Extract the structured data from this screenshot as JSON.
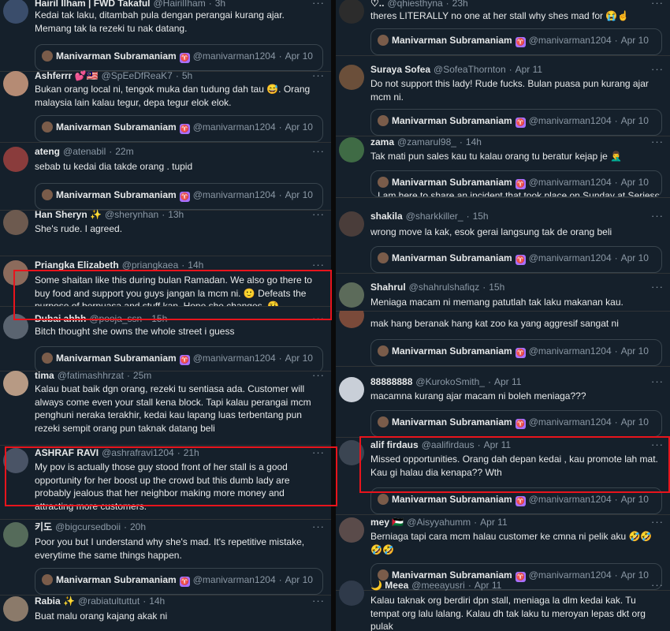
{
  "accent_color": "#e8141c",
  "badge_icon": "aries-sign-icon",
  "quote_author": {
    "name": "Manivarman Subramaniam",
    "handle": "@manivarman1204",
    "date": "Apr 10"
  },
  "left_column": [
    {
      "name": "Hairil Ilham | FWD Takaful",
      "handle": "@HairilIham",
      "time": "3h",
      "text": "Kedai tak laku, ditambah pula dengan perangai kurang ajar. Memang tak la rezeki tu nak datang."
    },
    {
      "name": "Ashferrr 💕🇲🇾",
      "handle": "@SpEeDfReaK7",
      "time": "5h",
      "text": "Bukan orang local ni, tengok muka dan tudung dah tau 😅. Orang malaysia lain kalau tegur, depa tegur elok elok."
    },
    {
      "name": "ateng",
      "handle": "@atenabil",
      "time": "22m",
      "text": "sebab tu kedai dia takde orang . tupid"
    },
    {
      "name": "Han Sheryn ✨",
      "handle": "@sherynhan",
      "time": "13h",
      "text": "She's rude. I agreed."
    },
    {
      "name": "Priangka Elizabeth",
      "handle": "@priangkaea",
      "time": "14h",
      "text": "Some shaitan like this during bulan Ramadan. We also go there to buy food and support you guys jangan la mcm ni. 🙂 Defeats the purpose of berpuasa and stuff kan. Hope she changes. 🤨"
    },
    {
      "name": "Dubai ahhh",
      "handle": "@pooja_ssn",
      "time": "15h",
      "text": "Bitch thought she owns the whole street i guess"
    },
    {
      "name": "tima",
      "handle": "@fatimashhrzat",
      "time": "25m",
      "text": "Kalau buat baik dgn orang, rezeki tu sentiasa ada. Customer will always come even your stall kena block. Tapi kalau perangai mcm penghuni neraka terakhir, kedai kau lapang luas terbentang pun rezeki sempit orang pun taknak datang beli"
    },
    {
      "name": "ASHRAF RAVI",
      "handle": "@ashrafravi1204",
      "time": "21h",
      "text": "My pov is actually those guy stood front of her stall is a good opportunity for her boost up the crowd but this dumb lady are probably jealous that her neighbor making more money and attracting more customers."
    },
    {
      "name": "키도",
      "handle": "@bigcursedboii",
      "time": "20h",
      "text": "Poor you but I understand why she's mad. It's repetitive mistake, everytime the same things happen."
    },
    {
      "name": "Rabia ✨",
      "handle": "@rabiatultuttut",
      "time": "14h",
      "text": "Buat malu orang kajang akak ni"
    }
  ],
  "right_column": [
    {
      "name": "♡..",
      "handle": "@qhiesthyna",
      "time": "23h",
      "text": "theres LITERALLY no one at her stall why shes mad for 😭☝️"
    },
    {
      "name": "Suraya Sofea",
      "handle": "@SofeaThornton",
      "time": "Apr 11",
      "text": "Do not support this lady! Rude fucks. Bulan puasa pun kurang ajar mcm ni."
    },
    {
      "name": "zama",
      "handle": "@zamarul98_",
      "time": "14h",
      "text": "Tak mati pun sales kau tu kalau orang tu beratur kejap je 🤦‍♂️",
      "quote_text": "I am here to share an incident that took place on Sunday at Seriese"
    },
    {
      "name": "shakila",
      "handle": "@sharkkiller_",
      "time": "15h",
      "text": "wrong move la kak, esok gerai langsung tak de orang beli"
    },
    {
      "name": "Shahrul",
      "handle": "@shahrulshafiqz",
      "time": "15h",
      "text": "Meniaga macam ni memang patutlah tak laku makanan kau."
    },
    {
      "name": "",
      "handle": "",
      "time": "",
      "text": "mak hang beranak hang  kat zoo ka yang aggresif sangat ni"
    },
    {
      "name": "88888888",
      "handle": "@KurokoSmith_",
      "time": "Apr 11",
      "text": "macamna kurang ajar macam ni boleh meniaga???"
    },
    {
      "name": "alif firdaus",
      "handle": "@aalifirdaus",
      "time": "Apr 11",
      "text": "Missed opportunities. Orang dah depan kedai , kau promote lah mat. Kau gi halau dia kenapa?? Wth"
    },
    {
      "name": "mey 🇵🇸",
      "handle": "@Aisyyahumm",
      "time": "Apr 11",
      "text": "Berniaga tapi cara mcm halau customer ke cmna ni pelik aku 🤣🤣🤣🤣"
    },
    {
      "name": "🌙 Meea",
      "handle": "@meeayusri",
      "time": "Apr 11",
      "text": "Kalau taknak org berdiri dpn stall, meniaga la dlm kedai kak. Tu tempat org lalu lalang. Kalau dh tak laku tu meroyan lepas dkt org pulak"
    }
  ]
}
